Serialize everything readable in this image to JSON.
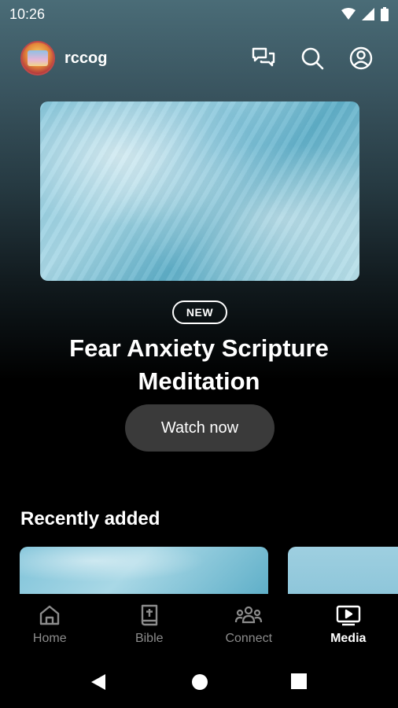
{
  "status": {
    "time": "10:26"
  },
  "header": {
    "app_name": "rccog"
  },
  "featured": {
    "badge": "NEW",
    "title": "Fear Anxiety Scripture Meditation",
    "cta_label": "Watch now"
  },
  "recent": {
    "title": "Recently added"
  },
  "nav": {
    "items": [
      {
        "label": "Home",
        "icon": "home-icon"
      },
      {
        "label": "Bible",
        "icon": "bible-icon"
      },
      {
        "label": "Connect",
        "icon": "people-icon"
      },
      {
        "label": "Media",
        "icon": "media-icon",
        "active": true
      }
    ]
  },
  "colors": {
    "inactive_nav": "#8c8c8c",
    "button_bg": "#3a3a3a"
  }
}
